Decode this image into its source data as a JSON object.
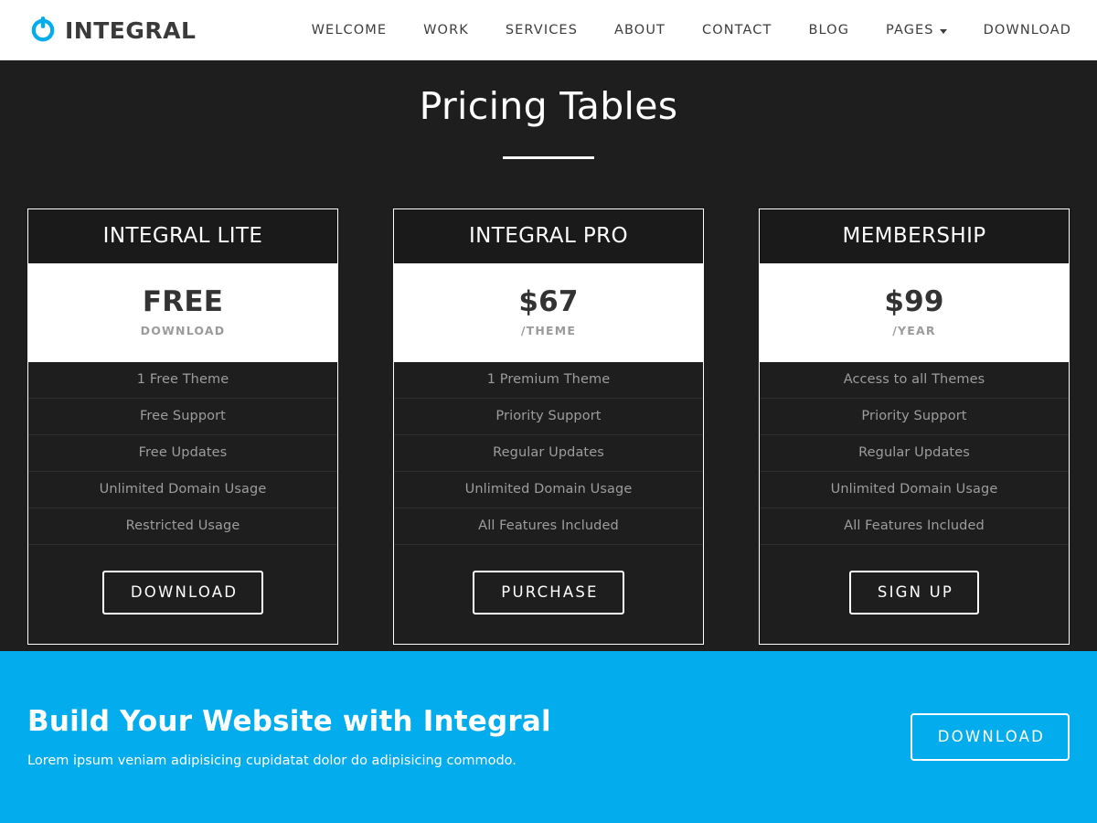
{
  "header": {
    "brand": {
      "name": "INTEGRAL",
      "icon": "power-button-icon",
      "color": "#03aced"
    },
    "nav": [
      {
        "label": "WELCOME",
        "has_caret": false
      },
      {
        "label": "WORK",
        "has_caret": false
      },
      {
        "label": "SERVICES",
        "has_caret": false
      },
      {
        "label": "ABOUT",
        "has_caret": false
      },
      {
        "label": "CONTACT",
        "has_caret": false
      },
      {
        "label": "BLOG",
        "has_caret": false
      },
      {
        "label": "PAGES",
        "has_caret": true
      },
      {
        "label": "DOWNLOAD",
        "has_caret": false
      }
    ]
  },
  "pricing": {
    "title": "Pricing Tables",
    "plans": [
      {
        "name": "INTEGRAL LITE",
        "price": "FREE",
        "period": "DOWNLOAD",
        "features": [
          "1 Free Theme",
          "Free Support",
          "Free Updates",
          "Unlimited Domain Usage",
          "Restricted Usage"
        ],
        "button": "DOWNLOAD"
      },
      {
        "name": "INTEGRAL PRO",
        "price": "$67",
        "period": "/THEME",
        "features": [
          "1 Premium Theme",
          "Priority Support",
          "Regular Updates",
          "Unlimited Domain Usage",
          "All Features Included"
        ],
        "button": "PURCHASE"
      },
      {
        "name": "MEMBERSHIP",
        "price": "$99",
        "period": "/YEAR",
        "features": [
          "Access to all Themes",
          "Priority Support",
          "Regular Updates",
          "Unlimited Domain Usage",
          "All Features Included"
        ],
        "button": "SIGN UP"
      }
    ]
  },
  "cta": {
    "title": "Build Your Website with Integral",
    "subtitle": "Lorem ipsum veniam adipisicing cupidatat dolor do adipisicing commodo.",
    "button": "DOWNLOAD",
    "background_color": "#03aced"
  },
  "theme": {
    "dark_background": "#1e1e1e",
    "accent": "#03aced",
    "card_border": "#ffffff"
  }
}
